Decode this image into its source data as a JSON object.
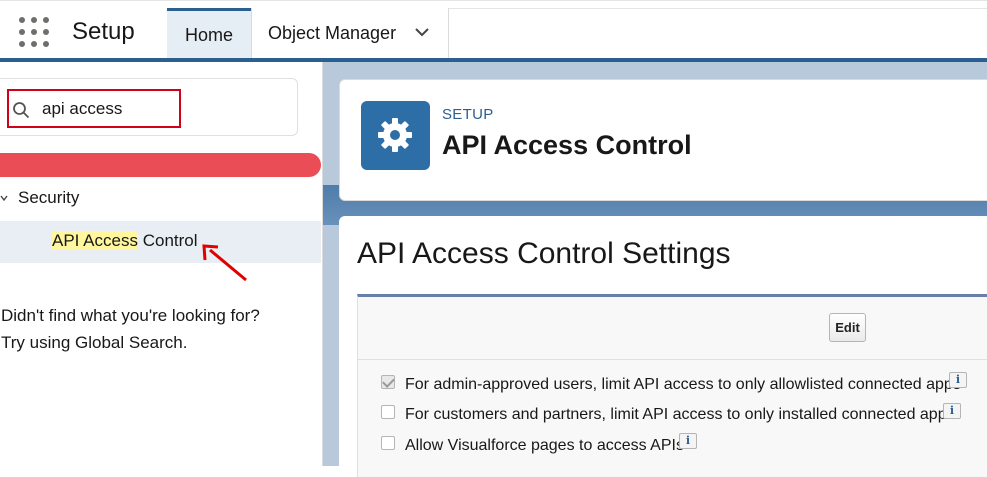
{
  "header": {
    "app_title": "Setup",
    "tabs": [
      {
        "label": "Home",
        "active": true
      },
      {
        "label": "Object Manager",
        "active": false
      }
    ]
  },
  "sidebar": {
    "search": {
      "value": "api access",
      "placeholder": ""
    },
    "tree": {
      "section": "Security",
      "item_parts": [
        "API Access",
        " Control"
      ]
    },
    "not_found_line1": "Didn't find what you're looking for?",
    "not_found_line2": "Try using Global Search."
  },
  "page": {
    "breadcrumb": "SETUP",
    "title": "API Access Control",
    "icon": "gear-icon"
  },
  "settings": {
    "title": "API Access Control Settings",
    "edit_label": "Edit",
    "options": [
      {
        "label": "For admin-approved users, limit API access to only allowlisted connected apps",
        "checked": true,
        "info": "i"
      },
      {
        "label": "For customers and partners, limit API access to only installed connected apps",
        "checked": false,
        "info": "i"
      },
      {
        "label": "Allow Visualforce pages to access APIs",
        "checked": false,
        "info": "i"
      }
    ]
  },
  "colors": {
    "brand": "#2a5f8f",
    "highlight_red": "#d0021b",
    "search_match": "#fff69e",
    "red_bar": "#ea4d55"
  }
}
